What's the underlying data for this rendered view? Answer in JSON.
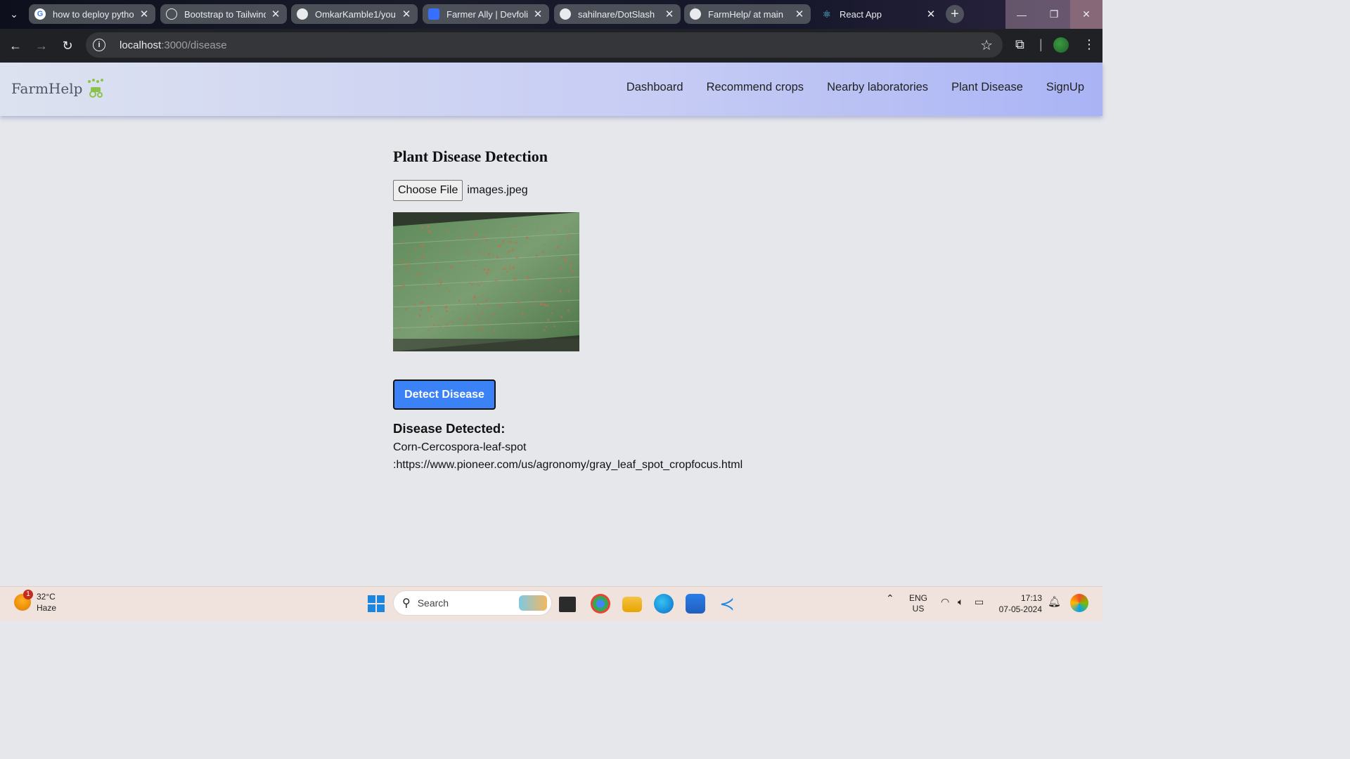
{
  "browser": {
    "tabs": [
      {
        "title": "how to deploy pytho",
        "favicon": "google-icon",
        "active": false
      },
      {
        "title": "Bootstrap to Tailwind",
        "favicon": "chatgpt-icon",
        "active": false
      },
      {
        "title": "OmkarKamble1/you",
        "favicon": "github-icon",
        "active": false
      },
      {
        "title": "Farmer Ally | Devfolio",
        "favicon": "devfolio-icon",
        "active": false
      },
      {
        "title": "sahilnare/DotSlash",
        "favicon": "github-icon",
        "active": false
      },
      {
        "title": "FarmHelp/ at main",
        "favicon": "github-icon",
        "active": false
      },
      {
        "title": "React App",
        "favicon": "react-icon",
        "active": true
      }
    ],
    "url_host": "localhost",
    "url_path": ":3000/disease"
  },
  "header": {
    "brand": "FarmHelp",
    "nav": [
      "Dashboard",
      "Recommend crops",
      "Nearby laboratories",
      "Plant Disease",
      "SignUp"
    ]
  },
  "main": {
    "title": "Plant Disease Detection",
    "choose_file_label": "Choose File",
    "file_name": "images.jpeg",
    "detect_button": "Detect Disease",
    "result_heading": "Disease Detected:",
    "result_disease": "Corn-Cercospora-leaf-spot",
    "result_link": ":https://www.pioneer.com/us/agronomy/gray_leaf_spot_cropfocus.html"
  },
  "taskbar": {
    "weather_temp": "32°C",
    "weather_desc": "Haze",
    "weather_badge": "1",
    "search_placeholder": "Search",
    "lang_top": "ENG",
    "lang_bottom": "US",
    "time": "17:13",
    "date": "07-05-2024"
  },
  "colors": {
    "detect_button": "#3b82f6",
    "header_gradient_end": "#aab4f5",
    "page_background": "#e5e7eb"
  }
}
